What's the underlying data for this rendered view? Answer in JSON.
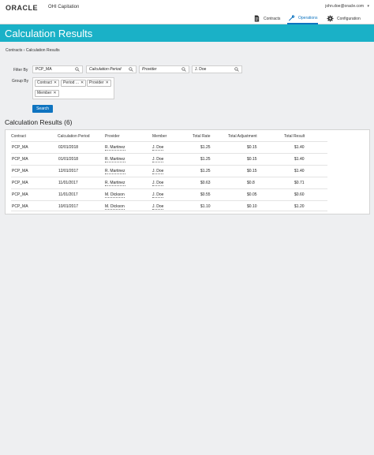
{
  "header": {
    "logo": "ORACLE",
    "app_name": "OHI Capitation",
    "user": "john.doe@oracle.com",
    "user_caret": "▾",
    "nav": [
      {
        "label": "Contracts",
        "icon": "document-icon"
      },
      {
        "label": "Operations",
        "icon": "wrench-icon",
        "active": true
      },
      {
        "label": "Configuration",
        "icon": "gear-icon"
      }
    ]
  },
  "page": {
    "title": "Calculation Results",
    "breadcrumb": "Contracts  ›  Calculation Results"
  },
  "filters": {
    "filter_label": "Filter By",
    "group_label": "Group By",
    "contract_value": "PCP_MA",
    "period_placeholder": "Calculation Period",
    "provider_placeholder": "Provider",
    "member_value": "J. Doe",
    "group_chips": [
      "Contract",
      "Period ...",
      "Provider",
      "Member"
    ],
    "search_label": "Search"
  },
  "results": {
    "title": "Calculation Results (6)",
    "columns": [
      "Contract",
      "Calculation Period",
      "Provider",
      "Member",
      "Total Rate",
      "Total Adjustment",
      "Total Result"
    ],
    "rows": [
      {
        "contract": "PCP_MA",
        "period": "02/01/2018",
        "provider": "R. Martinez",
        "member": "J. Doe",
        "rate": "$1.25",
        "adjustment": "$0.15",
        "result": "$1.40"
      },
      {
        "contract": "PCP_MA",
        "period": "01/01/2018",
        "provider": "R. Martinez",
        "member": "J. Doe",
        "rate": "$1.25",
        "adjustment": "$0.15",
        "result": "$1.40"
      },
      {
        "contract": "PCP_MA",
        "period": "12/01/2017",
        "provider": "R. Martinez",
        "member": "J. Doe",
        "rate": "$1.25",
        "adjustment": "$0.15",
        "result": "$1.40"
      },
      {
        "contract": "PCP_MA",
        "period": "11/01/2017",
        "provider": "R. Martinez",
        "member": "J. Doe",
        "rate": "$0.63",
        "adjustment": "$0.8",
        "result": "$0.71"
      },
      {
        "contract": "PCP_MA",
        "period": "11/01/2017",
        "provider": "M. Dickson",
        "member": "J. Doe",
        "rate": "$0.55",
        "adjustment": "$0.05",
        "result": "$0.60"
      },
      {
        "contract": "PCP_MA",
        "period": "10/01/2017",
        "provider": "M. Dickson",
        "member": "J. Doe",
        "rate": "$1.10",
        "adjustment": "$0.10",
        "result": "$1.20"
      }
    ]
  }
}
